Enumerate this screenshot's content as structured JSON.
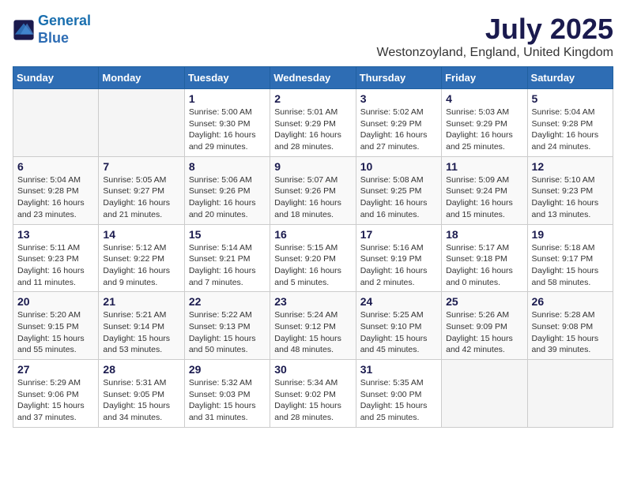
{
  "logo": {
    "line1": "General",
    "line2": "Blue"
  },
  "title": "July 2025",
  "location": "Westonzoyland, England, United Kingdom",
  "weekdays": [
    "Sunday",
    "Monday",
    "Tuesday",
    "Wednesday",
    "Thursday",
    "Friday",
    "Saturday"
  ],
  "weeks": [
    [
      {
        "day": null
      },
      {
        "day": null
      },
      {
        "day": 1,
        "sunrise": "Sunrise: 5:00 AM",
        "sunset": "Sunset: 9:30 PM",
        "daylight": "Daylight: 16 hours and 29 minutes."
      },
      {
        "day": 2,
        "sunrise": "Sunrise: 5:01 AM",
        "sunset": "Sunset: 9:29 PM",
        "daylight": "Daylight: 16 hours and 28 minutes."
      },
      {
        "day": 3,
        "sunrise": "Sunrise: 5:02 AM",
        "sunset": "Sunset: 9:29 PM",
        "daylight": "Daylight: 16 hours and 27 minutes."
      },
      {
        "day": 4,
        "sunrise": "Sunrise: 5:03 AM",
        "sunset": "Sunset: 9:29 PM",
        "daylight": "Daylight: 16 hours and 25 minutes."
      },
      {
        "day": 5,
        "sunrise": "Sunrise: 5:04 AM",
        "sunset": "Sunset: 9:28 PM",
        "daylight": "Daylight: 16 hours and 24 minutes."
      }
    ],
    [
      {
        "day": 6,
        "sunrise": "Sunrise: 5:04 AM",
        "sunset": "Sunset: 9:28 PM",
        "daylight": "Daylight: 16 hours and 23 minutes."
      },
      {
        "day": 7,
        "sunrise": "Sunrise: 5:05 AM",
        "sunset": "Sunset: 9:27 PM",
        "daylight": "Daylight: 16 hours and 21 minutes."
      },
      {
        "day": 8,
        "sunrise": "Sunrise: 5:06 AM",
        "sunset": "Sunset: 9:26 PM",
        "daylight": "Daylight: 16 hours and 20 minutes."
      },
      {
        "day": 9,
        "sunrise": "Sunrise: 5:07 AM",
        "sunset": "Sunset: 9:26 PM",
        "daylight": "Daylight: 16 hours and 18 minutes."
      },
      {
        "day": 10,
        "sunrise": "Sunrise: 5:08 AM",
        "sunset": "Sunset: 9:25 PM",
        "daylight": "Daylight: 16 hours and 16 minutes."
      },
      {
        "day": 11,
        "sunrise": "Sunrise: 5:09 AM",
        "sunset": "Sunset: 9:24 PM",
        "daylight": "Daylight: 16 hours and 15 minutes."
      },
      {
        "day": 12,
        "sunrise": "Sunrise: 5:10 AM",
        "sunset": "Sunset: 9:23 PM",
        "daylight": "Daylight: 16 hours and 13 minutes."
      }
    ],
    [
      {
        "day": 13,
        "sunrise": "Sunrise: 5:11 AM",
        "sunset": "Sunset: 9:23 PM",
        "daylight": "Daylight: 16 hours and 11 minutes."
      },
      {
        "day": 14,
        "sunrise": "Sunrise: 5:12 AM",
        "sunset": "Sunset: 9:22 PM",
        "daylight": "Daylight: 16 hours and 9 minutes."
      },
      {
        "day": 15,
        "sunrise": "Sunrise: 5:14 AM",
        "sunset": "Sunset: 9:21 PM",
        "daylight": "Daylight: 16 hours and 7 minutes."
      },
      {
        "day": 16,
        "sunrise": "Sunrise: 5:15 AM",
        "sunset": "Sunset: 9:20 PM",
        "daylight": "Daylight: 16 hours and 5 minutes."
      },
      {
        "day": 17,
        "sunrise": "Sunrise: 5:16 AM",
        "sunset": "Sunset: 9:19 PM",
        "daylight": "Daylight: 16 hours and 2 minutes."
      },
      {
        "day": 18,
        "sunrise": "Sunrise: 5:17 AM",
        "sunset": "Sunset: 9:18 PM",
        "daylight": "Daylight: 16 hours and 0 minutes."
      },
      {
        "day": 19,
        "sunrise": "Sunrise: 5:18 AM",
        "sunset": "Sunset: 9:17 PM",
        "daylight": "Daylight: 15 hours and 58 minutes."
      }
    ],
    [
      {
        "day": 20,
        "sunrise": "Sunrise: 5:20 AM",
        "sunset": "Sunset: 9:15 PM",
        "daylight": "Daylight: 15 hours and 55 minutes."
      },
      {
        "day": 21,
        "sunrise": "Sunrise: 5:21 AM",
        "sunset": "Sunset: 9:14 PM",
        "daylight": "Daylight: 15 hours and 53 minutes."
      },
      {
        "day": 22,
        "sunrise": "Sunrise: 5:22 AM",
        "sunset": "Sunset: 9:13 PM",
        "daylight": "Daylight: 15 hours and 50 minutes."
      },
      {
        "day": 23,
        "sunrise": "Sunrise: 5:24 AM",
        "sunset": "Sunset: 9:12 PM",
        "daylight": "Daylight: 15 hours and 48 minutes."
      },
      {
        "day": 24,
        "sunrise": "Sunrise: 5:25 AM",
        "sunset": "Sunset: 9:10 PM",
        "daylight": "Daylight: 15 hours and 45 minutes."
      },
      {
        "day": 25,
        "sunrise": "Sunrise: 5:26 AM",
        "sunset": "Sunset: 9:09 PM",
        "daylight": "Daylight: 15 hours and 42 minutes."
      },
      {
        "day": 26,
        "sunrise": "Sunrise: 5:28 AM",
        "sunset": "Sunset: 9:08 PM",
        "daylight": "Daylight: 15 hours and 39 minutes."
      }
    ],
    [
      {
        "day": 27,
        "sunrise": "Sunrise: 5:29 AM",
        "sunset": "Sunset: 9:06 PM",
        "daylight": "Daylight: 15 hours and 37 minutes."
      },
      {
        "day": 28,
        "sunrise": "Sunrise: 5:31 AM",
        "sunset": "Sunset: 9:05 PM",
        "daylight": "Daylight: 15 hours and 34 minutes."
      },
      {
        "day": 29,
        "sunrise": "Sunrise: 5:32 AM",
        "sunset": "Sunset: 9:03 PM",
        "daylight": "Daylight: 15 hours and 31 minutes."
      },
      {
        "day": 30,
        "sunrise": "Sunrise: 5:34 AM",
        "sunset": "Sunset: 9:02 PM",
        "daylight": "Daylight: 15 hours and 28 minutes."
      },
      {
        "day": 31,
        "sunrise": "Sunrise: 5:35 AM",
        "sunset": "Sunset: 9:00 PM",
        "daylight": "Daylight: 15 hours and 25 minutes."
      },
      {
        "day": null
      },
      {
        "day": null
      }
    ]
  ]
}
